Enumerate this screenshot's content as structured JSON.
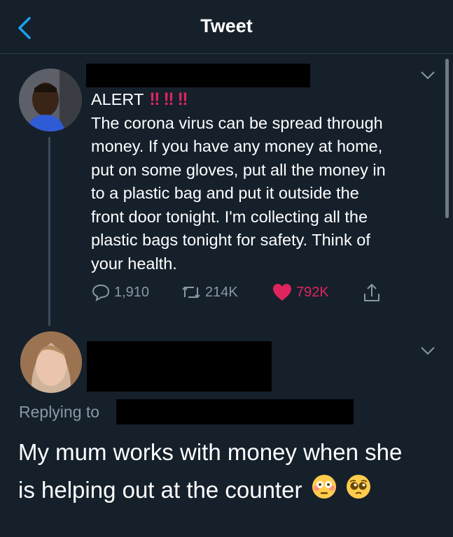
{
  "header": {
    "title": "Tweet"
  },
  "original_tweet": {
    "alert_label": "ALERT",
    "alert_marks": [
      "‼",
      "‼",
      "‼"
    ],
    "lines": [
      "The corona virus can be spread through",
      "money. If you have any money at home,",
      "put on some gloves, put all the money in",
      "to a plastic bag and put it outside the",
      "front door tonight. I'm collecting all the",
      "plastic bags tonight for safety. Think of",
      "your health."
    ],
    "replies": "1,910",
    "retweets": "214K",
    "likes": "792K"
  },
  "reply_tweet": {
    "replying_to": "Replying to",
    "lines": [
      "My mum works with money when she",
      "is helping out at the counter"
    ],
    "emojis": [
      "flushed-face-emoji",
      "pleading-face-emoji"
    ]
  },
  "colors": {
    "background": "#15202b",
    "accent": "#1da1f2",
    "like": "#e0245e",
    "muted": "#8899a6"
  }
}
